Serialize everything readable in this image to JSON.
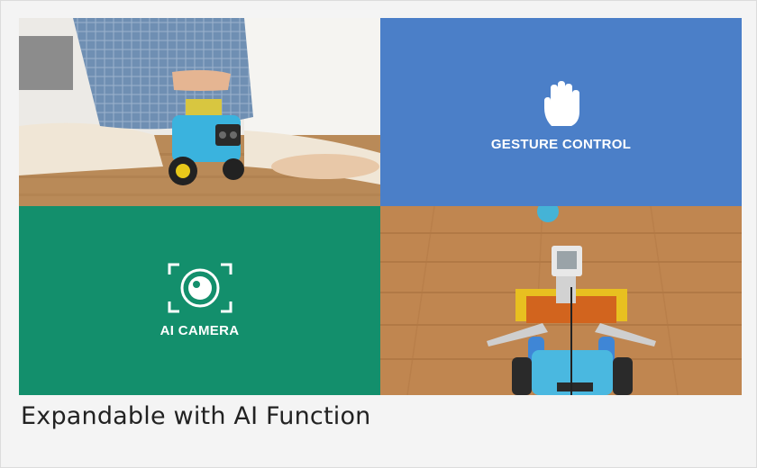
{
  "tiles": {
    "gesture": {
      "label": "GESTURE CONTROL",
      "icon": "hand-icon",
      "color": "#4b7fc8"
    },
    "camera": {
      "label": "AI CAMERA",
      "icon": "camera-lens-icon",
      "color": "#138f6c"
    },
    "photo_child": {
      "subject": "child-gesturing-at-robot-car-photo"
    },
    "photo_robot": {
      "subject": "robot-car-with-camera-photo"
    }
  },
  "caption": {
    "text": "Expandable with AI Function"
  }
}
